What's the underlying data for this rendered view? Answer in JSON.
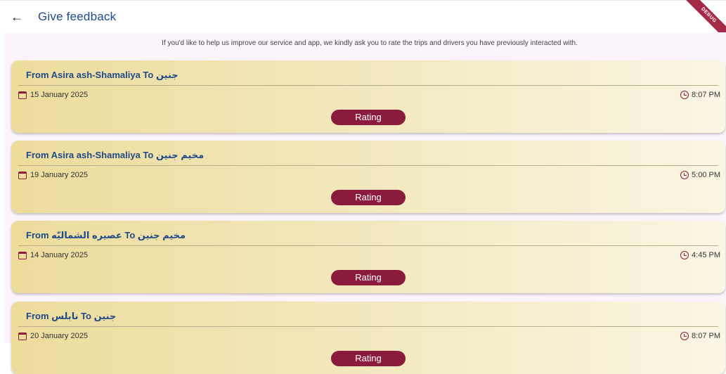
{
  "header": {
    "back_label": "←",
    "title": "Give feedback",
    "debug_banner": "DEBUG"
  },
  "intro": "If you'd like to help us improve our service and app, we kindly ask you to rate the trips and drivers you have previously interacted with.",
  "trips": [
    {
      "route": "From Asira ash-Shamaliya To جنين",
      "date": "15 January 2025",
      "time": "8:07 PM",
      "button": "Rating"
    },
    {
      "route": "From Asira ash-Shamaliya To مخيم جنين",
      "date": "19 January 2025",
      "time": "5:00 PM",
      "button": "Rating"
    },
    {
      "route": "From عصيره الشماليّه To مخيم جنين",
      "date": "14 January 2025",
      "time": "4:45 PM",
      "button": "Rating"
    },
    {
      "route": "From نابلس To جنين",
      "date": "20 January 2025",
      "time": "8:07 PM",
      "button": "Rating"
    }
  ],
  "icons": {
    "back": "arrow-left-icon",
    "date": "calendar-icon",
    "time": "clock-icon"
  },
  "colors": {
    "accent": "#8b1b3c",
    "title": "#1f4a8a",
    "background": "#fbf4fb"
  }
}
